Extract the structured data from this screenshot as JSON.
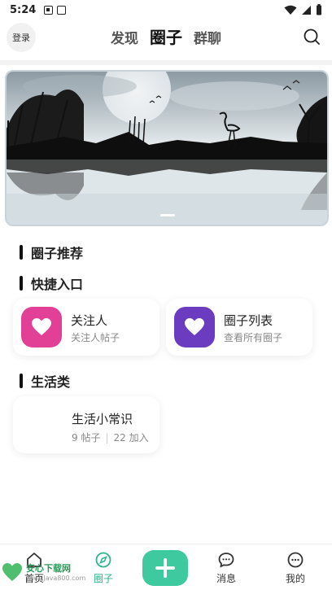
{
  "status_bar": {
    "time": "5:24"
  },
  "header": {
    "login_label": "登录",
    "tabs": [
      {
        "label": "发现"
      },
      {
        "label": "圈子"
      },
      {
        "label": "群聊"
      }
    ]
  },
  "banner": {
    "slide_count": 1,
    "active_slide": 1
  },
  "sections": {
    "recommend_title": "圈子推荐",
    "quick_title": "快捷入口",
    "life_title": "生活类"
  },
  "quick_cards": [
    {
      "title": "关注人",
      "subtitle": "关注人帖子",
      "icon": "heart-icon",
      "color": "#e23f96"
    },
    {
      "title": "圈子列表",
      "subtitle": "查看所有圈子",
      "icon": "heart-icon",
      "color": "#6c3cc0"
    }
  ],
  "life_cards": [
    {
      "title": "生活小常识",
      "posts": "9 帖子",
      "joined": "22 加入"
    }
  ],
  "bottom_nav": {
    "items": [
      {
        "label": "首页",
        "icon": "home-icon"
      },
      {
        "label": "圈子",
        "icon": "compass-icon"
      },
      {
        "label": "消息",
        "icon": "chat-icon"
      },
      {
        "label": "我的",
        "icon": "more-icon"
      }
    ],
    "active_color": "#2bb58e",
    "fab_color": "#3ec99e"
  },
  "watermark": {
    "title": "安心下载网",
    "url": "www.Java800.com"
  }
}
